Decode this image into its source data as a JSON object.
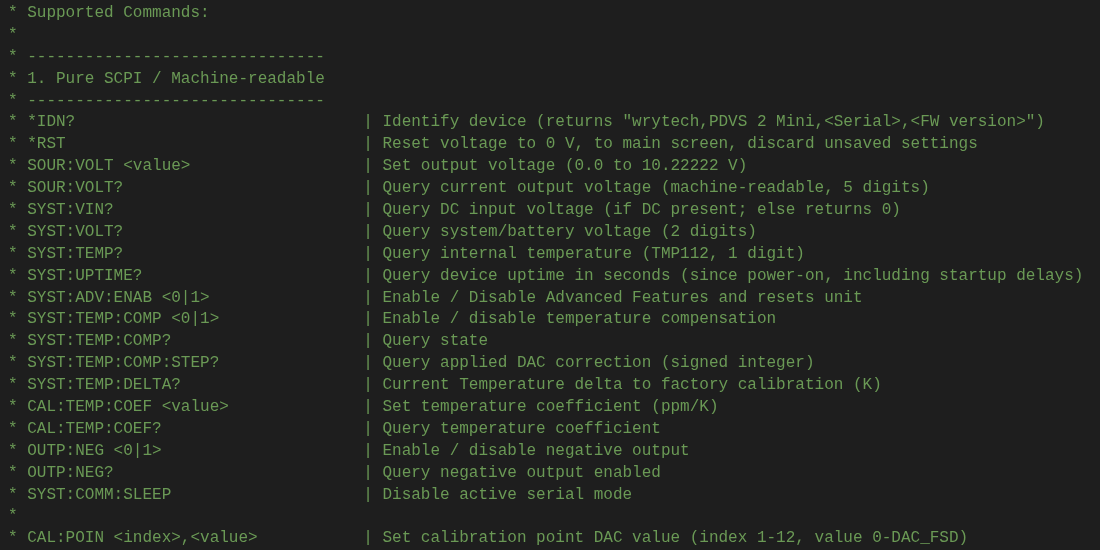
{
  "lines": [
    {
      "kind": "text",
      "prefix": "*",
      "text": "Supported Commands:"
    },
    {
      "kind": "blank",
      "prefix": "*"
    },
    {
      "kind": "text",
      "prefix": "*",
      "text": "-------------------------------"
    },
    {
      "kind": "text",
      "prefix": "*",
      "text": "1. Pure SCPI / Machine-readable"
    },
    {
      "kind": "text",
      "prefix": "*",
      "text": "-------------------------------"
    },
    {
      "kind": "command",
      "prefix": "*",
      "command": "*IDN?",
      "separator": "|",
      "description": "Identify device (returns \"wrytech,PDVS 2 Mini,<Serial>,<FW version>\")"
    },
    {
      "kind": "command",
      "prefix": "*",
      "command": "*RST",
      "separator": "|",
      "description": "Reset voltage to 0 V, to main screen, discard unsaved settings"
    },
    {
      "kind": "command",
      "prefix": "*",
      "command": "SOUR:VOLT <value>",
      "separator": "|",
      "description": "Set output voltage (0.0 to 10.22222 V)"
    },
    {
      "kind": "command",
      "prefix": "*",
      "command": "SOUR:VOLT?",
      "separator": "|",
      "description": "Query current output voltage (machine-readable, 5 digits)"
    },
    {
      "kind": "command",
      "prefix": "*",
      "command": "SYST:VIN?",
      "separator": "|",
      "description": "Query DC input voltage (if DC present; else returns 0)"
    },
    {
      "kind": "command",
      "prefix": "*",
      "command": "SYST:VOLT?",
      "separator": "|",
      "description": "Query system/battery voltage (2 digits)"
    },
    {
      "kind": "command",
      "prefix": "*",
      "command": "SYST:TEMP?",
      "separator": "|",
      "description": "Query internal temperature (TMP112, 1 digit)"
    },
    {
      "kind": "command",
      "prefix": "*",
      "command": "SYST:UPTIME?",
      "separator": "|",
      "description": "Query device uptime in seconds (since power-on, including startup delays)"
    },
    {
      "kind": "command",
      "prefix": "*",
      "command": "SYST:ADV:ENAB <0|1>",
      "separator": "|",
      "description": "Enable / Disable Advanced Features and resets unit"
    },
    {
      "kind": "command",
      "prefix": "*",
      "command": "SYST:TEMP:COMP <0|1>",
      "separator": "|",
      "description": "Enable / disable temperature compensation"
    },
    {
      "kind": "command",
      "prefix": "*",
      "command": "SYST:TEMP:COMP?",
      "separator": "|",
      "description": "Query state"
    },
    {
      "kind": "command",
      "prefix": "*",
      "command": "SYST:TEMP:COMP:STEP?",
      "separator": "|",
      "description": "Query applied DAC correction (signed integer)"
    },
    {
      "kind": "command",
      "prefix": "*",
      "command": "SYST:TEMP:DELTA?",
      "separator": "|",
      "description": "Current Temperature delta to factory calibration (K)"
    },
    {
      "kind": "command",
      "prefix": "*",
      "command": "CAL:TEMP:COEF <value>",
      "separator": "|",
      "description": "Set temperature coefficient (ppm/K)"
    },
    {
      "kind": "command",
      "prefix": "*",
      "command": "CAL:TEMP:COEF?",
      "separator": "|",
      "description": "Query temperature coefficient"
    },
    {
      "kind": "command",
      "prefix": "*",
      "command": "OUTP:NEG <0|1>",
      "separator": "|",
      "description": "Enable / disable negative output"
    },
    {
      "kind": "command",
      "prefix": "*",
      "command": "OUTP:NEG?",
      "separator": "|",
      "description": "Query negative output enabled"
    },
    {
      "kind": "command",
      "prefix": "*",
      "command": "SYST:COMM:SLEEP",
      "separator": "|",
      "description": "Disable active serial mode"
    },
    {
      "kind": "blank",
      "prefix": "*"
    },
    {
      "kind": "command",
      "prefix": "*",
      "command": "CAL:POIN <index>,<value>",
      "separator": "|",
      "description": "Set calibration point DAC value (index 1-12, value 0-DAC_FSD)"
    }
  ]
}
